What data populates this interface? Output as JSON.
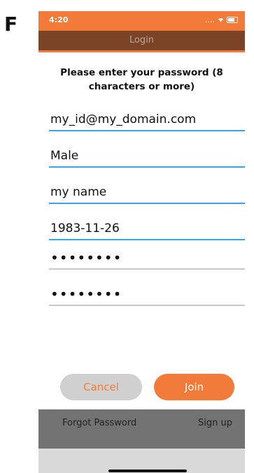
{
  "panel_label": "F",
  "status_bar": {
    "time": "4:20",
    "signal": "....",
    "wifi": "wifi-icon",
    "battery": "battery-icon"
  },
  "header": {
    "title": "Login"
  },
  "instruction": "Please enter your password (8 characters or more)",
  "fields": {
    "email": "my_id@my_domain.com",
    "gender": "Male",
    "name": "my name",
    "birthdate": "1983-11-26",
    "password": "••••••••",
    "password_confirm": "••••••••"
  },
  "buttons": {
    "cancel": "Cancel",
    "join": "Join"
  },
  "footer": {
    "forgot_password": "Forgot Password",
    "sign_up": "Sign up"
  },
  "colors": {
    "accent": "#f37b39",
    "header_bg": "#7b4426",
    "field_line": "#3aa2e6",
    "footer_bg": "#737373"
  }
}
